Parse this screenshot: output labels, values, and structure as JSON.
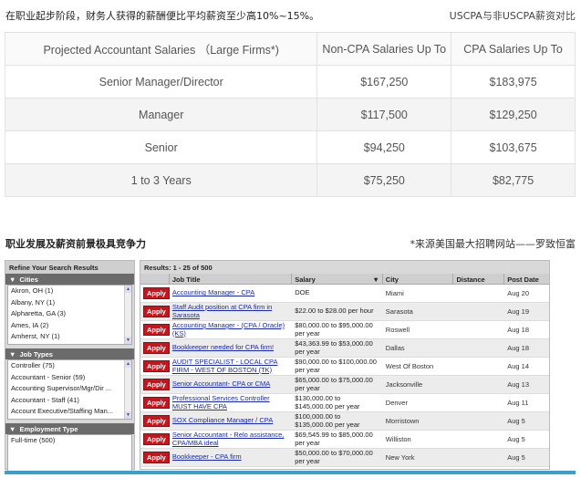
{
  "captions": {
    "top_left": "在职业起步阶段，财务人获得的薪酬便比平均薪资至少高10%~15%。",
    "top_right": "USCPA与非USCPA薪资对比",
    "section_title": "职业发展及薪资前景极具竞争力",
    "source_note": "*来源美国最大招聘网站——罗致恒富"
  },
  "salary_table": {
    "headers": [
      "Projected Accountant Salaries （Large Firms*)",
      "Non-CPA Salaries Up To",
      "CPA Salaries Up To"
    ],
    "rows": [
      [
        "Senior Manager/Director",
        "$167,250",
        "$183,975"
      ],
      [
        "Manager",
        "$117,500",
        "$129,250"
      ],
      [
        "Senior",
        "$94,250",
        "$103,675"
      ],
      [
        "1 to 3 Years",
        "$75,250",
        "$82,775"
      ]
    ]
  },
  "refine": {
    "title": "Refine Your Search Results",
    "facets": [
      {
        "name": "Cities",
        "items": [
          "Akron, OH (1)",
          "Albany, NY (1)",
          "Alpharetta, GA (3)",
          "Ames, IA (2)",
          "Amherst, NY (1)"
        ]
      },
      {
        "name": "Job Types",
        "items": [
          "Controller (75)",
          "Accountant - Senior (59)",
          "Accounting Supervisor/Mgr/Dir ...",
          "Accountant - Staff (41)",
          "Account Executive/Staffing Man..."
        ]
      },
      {
        "name": "Employment Type",
        "items": [
          "Full-time (500)"
        ]
      }
    ]
  },
  "results": {
    "summary": "Results: 1 - 25 of 500",
    "columns": [
      "",
      "Job Title",
      "Salary",
      "City",
      "Distance",
      "Post Date"
    ],
    "apply_label": "Apply",
    "sort_icon": "▼",
    "rows": [
      {
        "title": "Accounting Manager - CPA",
        "salary": "DOE",
        "city": "Miami",
        "distance": "",
        "date": "Aug 20"
      },
      {
        "title": "Staff Audit position at CPA firm in Sarasota",
        "salary": "$22.00 to $28.00 per hour",
        "city": "Sarasota",
        "distance": "",
        "date": "Aug 19"
      },
      {
        "title": "Accounting Manager - (CPA / Oracle) (KS)",
        "salary": "$80,000.00 to $95,000.00 per year",
        "city": "Roswell",
        "distance": "",
        "date": "Aug 18"
      },
      {
        "title": "Bookkeeper needed for CPA firm!",
        "salary": "$43,363.99 to $53,000.00 per year",
        "city": "Dallas",
        "distance": "",
        "date": "Aug 18"
      },
      {
        "title": "AUDIT SPECIALIST - LOCAL CPA FIRM - WEST OF BOSTON (TK)",
        "salary": "$90,000.00 to $100,000.00 per year",
        "city": "West Of Boston",
        "distance": "",
        "date": "Aug 14"
      },
      {
        "title": "Senior Accountant- CPA or CMA",
        "salary": "$65,000.00 to $75,000.00 per year",
        "city": "Jacksonville",
        "distance": "",
        "date": "Aug 13"
      },
      {
        "title": "Professional Services Controller MUST HAVE CPA",
        "salary": "$130,000.00 to $145,000.00 per year",
        "city": "Denver",
        "distance": "",
        "date": "Aug 11"
      },
      {
        "title": "SOX Compliance Manager / CPA",
        "salary": "$100,000.00 to $135,000.00 per year",
        "city": "Morristown",
        "distance": "",
        "date": "Aug 5"
      },
      {
        "title": "Senior Accountant - Relo assistance, CPA/MBA ideal",
        "salary": "$69,545.99 to $85,000.00 per year",
        "city": "Williston",
        "distance": "",
        "date": "Aug 5"
      },
      {
        "title": "Bookkeeper - CPA firm",
        "salary": "$50,000.00 to $70,000.00 per year",
        "city": "New York",
        "distance": "",
        "date": "Aug 5"
      }
    ]
  }
}
